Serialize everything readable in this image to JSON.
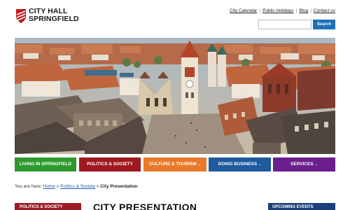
{
  "logo": {
    "line1": "CITY HALL",
    "line2": "SPRINGFIELD",
    "shield_colors": [
      "#c4161c",
      "#ffffff"
    ]
  },
  "utility_nav": {
    "items": [
      {
        "label": "City Calendar"
      },
      {
        "label": "Public Holidays"
      },
      {
        "label": "Blog"
      },
      {
        "label": "Contact us"
      }
    ],
    "separator": "|"
  },
  "search": {
    "placeholder": "",
    "button_label": "Search",
    "button_color": "#1f6fb5"
  },
  "hero": {
    "icon": "city-panorama-photo"
  },
  "main_nav": {
    "items": [
      {
        "label": "LIVING IN SPRINGFIELD",
        "color": "#2e9a2e",
        "has_dropdown": false
      },
      {
        "label": "POLITICS & SOCIETY",
        "color": "#a0181f",
        "has_dropdown": false
      },
      {
        "label": "CULTURE & TOURISM",
        "color": "#e8782a",
        "has_dropdown": true
      },
      {
        "label": "DOING BUSINESS",
        "color": "#1d5a9e",
        "has_dropdown": true
      },
      {
        "label": "SERVICES",
        "color": "#6b1f8c",
        "has_dropdown": true
      }
    ],
    "dropdown_glyph": "⌄"
  },
  "breadcrumb": {
    "prefix": "You are here:",
    "links": [
      {
        "label": "Home"
      },
      {
        "label": "Politics & Society"
      }
    ],
    "separator": "»",
    "current": "City Presentation"
  },
  "sidebar": {
    "header": "POLITICS & SOCIETY",
    "color": "#9b1b23"
  },
  "main": {
    "title": "CITY PRESENTATION"
  },
  "events": {
    "header": "UPCOMING EVENTS",
    "color": "#1d3f7a"
  }
}
